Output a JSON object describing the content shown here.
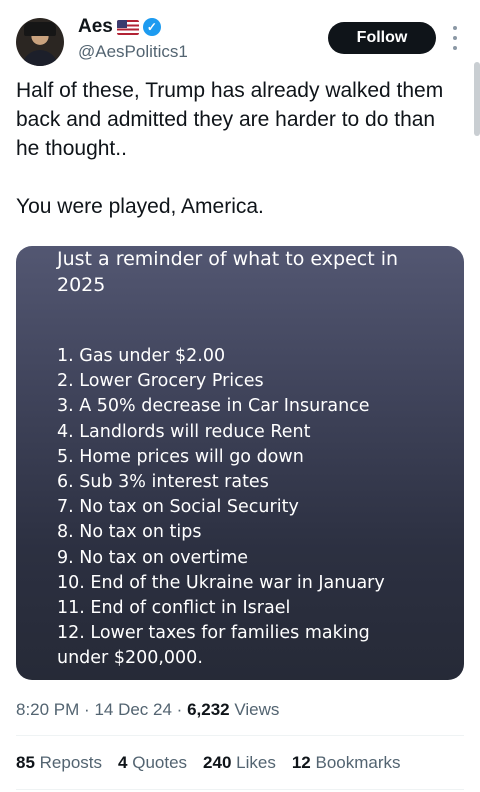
{
  "author": {
    "name": "Aes",
    "flag_icon": "us-flag-icon",
    "verified_icon": "verified-badge-icon",
    "handle": "@AesPolitics1"
  },
  "follow_label": "Follow",
  "tweet": {
    "line1": "Half of these, Trump has already walked them back and admitted they are harder to do than he thought..",
    "line2": "You were played, America."
  },
  "media": {
    "title": "Just a reminder of what to expect in 2025",
    "items": [
      "1. Gas under $2.00",
      "2. Lower Grocery Prices",
      "3. A 50% decrease in Car Insurance",
      "4. Landlords will reduce Rent",
      "5. Home prices will go down",
      "6. Sub 3% interest rates",
      "7. No tax on Social Security",
      "8. No tax on tips",
      "9. No tax on overtime",
      "10. End of the Ukraine war in January",
      "11. End of conflict in Israel",
      "12. Lower taxes for families making",
      "under $200,000."
    ]
  },
  "meta": {
    "time": "8:20 PM",
    "date": "14 Dec 24",
    "views_count": "6,232",
    "views_label": "Views"
  },
  "stats": {
    "reposts_count": "85",
    "reposts_label": "Reposts",
    "quotes_count": "4",
    "quotes_label": "Quotes",
    "likes_count": "240",
    "likes_label": "Likes",
    "bookmarks_count": "12",
    "bookmarks_label": "Bookmarks"
  },
  "colors": {
    "accent": "#1d9bf0",
    "follow_bg": "#0f1419",
    "muted_text": "#536471"
  }
}
